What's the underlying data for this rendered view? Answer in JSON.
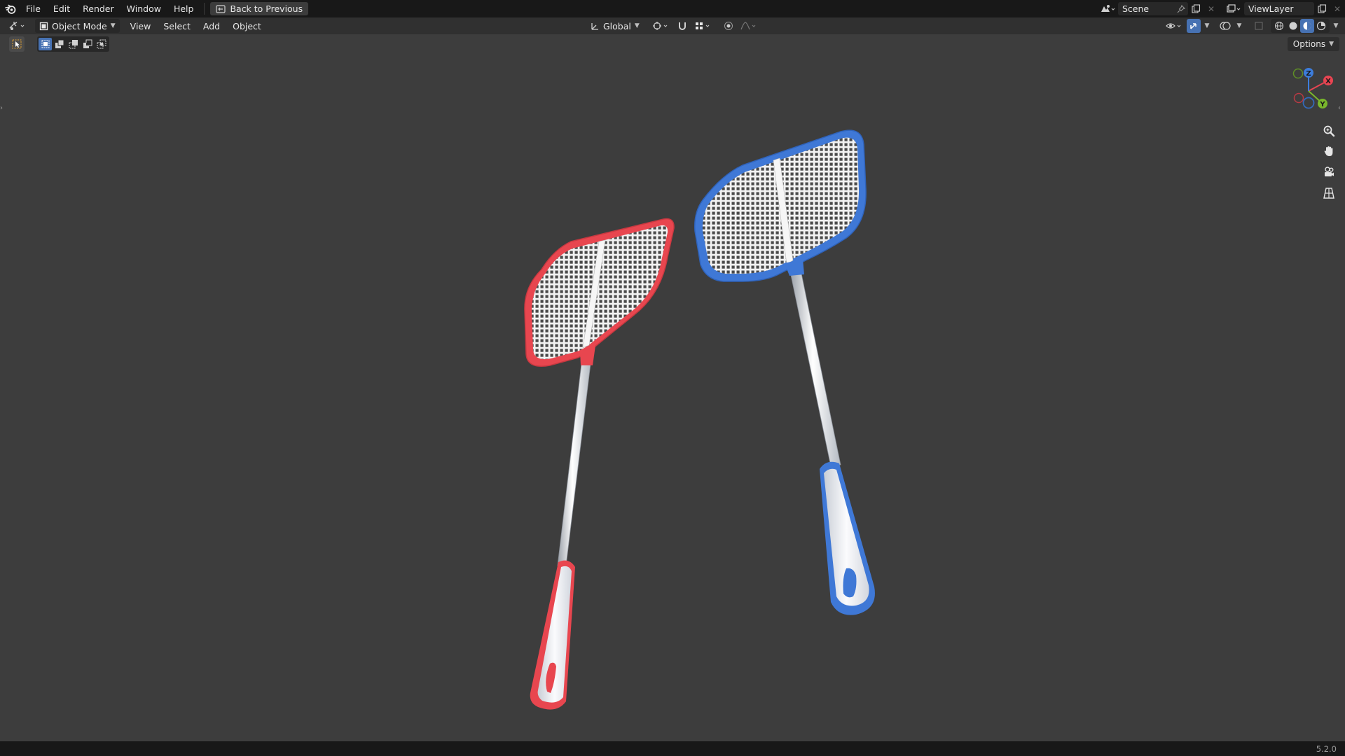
{
  "topbar": {
    "menus": [
      "File",
      "Edit",
      "Render",
      "Window",
      "Help"
    ],
    "back_label": "Back to Previous",
    "scene_name": "Scene",
    "view_layer": "ViewLayer"
  },
  "header": {
    "mode": "Object Mode",
    "menus": [
      "View",
      "Select",
      "Add",
      "Object"
    ],
    "orientation": "Global",
    "options_label": "Options"
  },
  "gizmo": {
    "x_label": "X",
    "y_label": "Y",
    "z_label": "Z"
  },
  "status": {
    "version": "5.2.0"
  },
  "colors": {
    "accent": "#4772b3",
    "swatter_left": "#e8464f",
    "swatter_right": "#3f78d6",
    "axis_x": "#e84552",
    "axis_y": "#79b72c",
    "axis_z": "#3d7ddc"
  }
}
